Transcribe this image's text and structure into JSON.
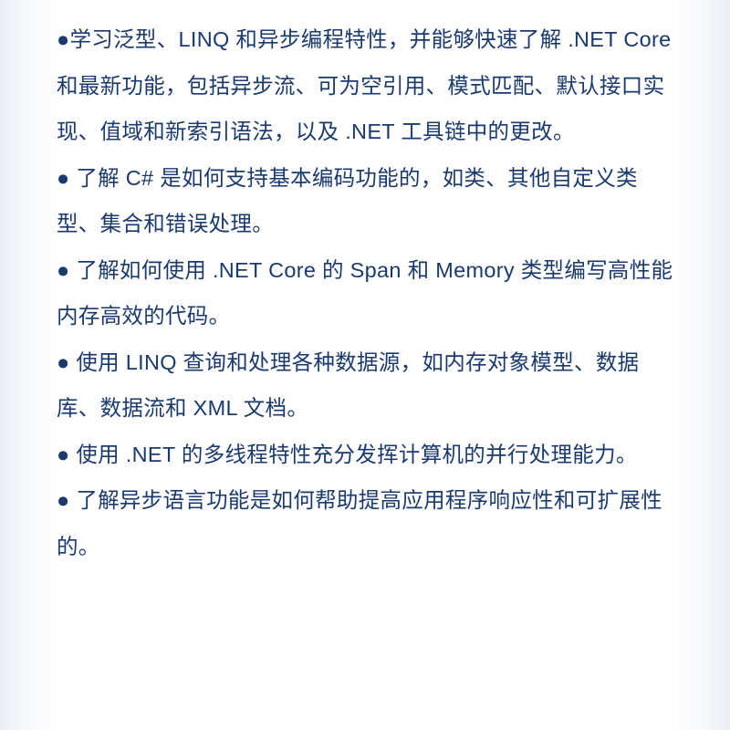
{
  "bullets": [
    {
      "marker": "●",
      "text": "学习泛型、LINQ 和异步编程特性，并能够快速了解 .NET Core 和最新功能，包括异步流、可为空引用、模式匹配、默认接口实现、值域和新索引语法，以及 .NET 工具链中的更改。"
    },
    {
      "marker": "●",
      "text": " 了解 C# 是如何支持基本编码功能的，如类、其他自定义类型、集合和错误处理。"
    },
    {
      "marker": "●",
      "text": " 了解如何使用 .NET Core 的 Span 和 Memory 类型编写高性能内存高效的代码。"
    },
    {
      "marker": "●",
      "text": " 使用 LINQ 查询和处理各种数据源，如内存对象模型、数据库、数据流和 XML 文档。"
    },
    {
      "marker": "●",
      "text": " 使用 .NET 的多线程特性充分发挥计算机的并行处理能力。"
    },
    {
      "marker": "●",
      "text": " 了解异步语言功能是如何帮助提高应用程序响应性和可扩展性的。"
    }
  ]
}
